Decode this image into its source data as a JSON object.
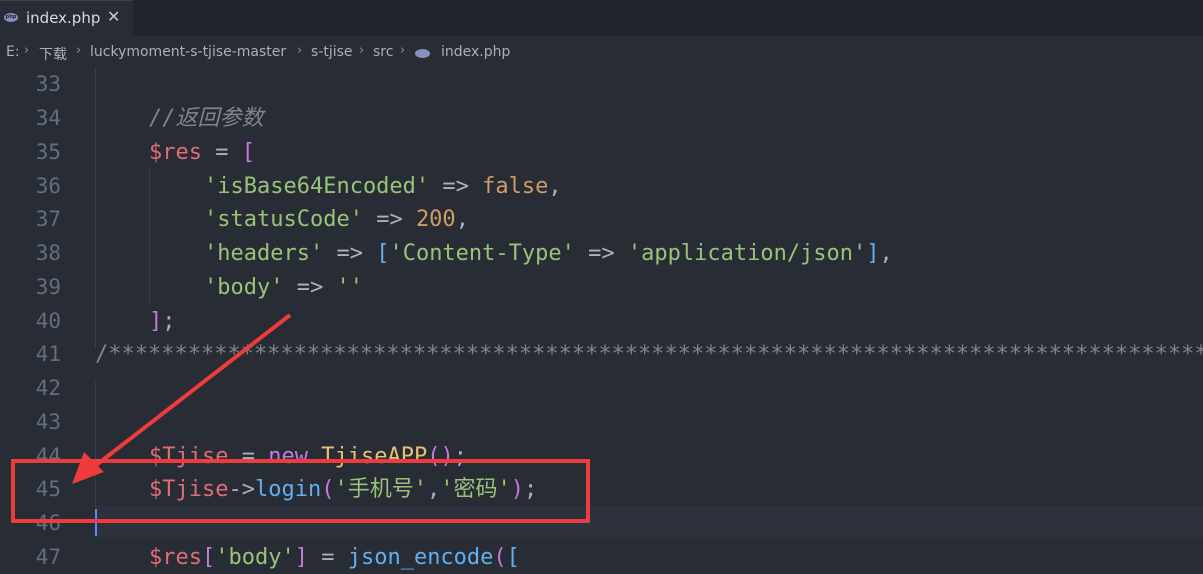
{
  "tab": {
    "title": "index.php",
    "close": "✕"
  },
  "breadcrumb": [
    "E:",
    "下载",
    "luckymoment-s-tjise-master",
    "s-tjise",
    "src",
    "index.php"
  ],
  "code": {
    "l33": "",
    "l34": "//返回参数",
    "l35a": "$res",
    "l35b": " = ",
    "l35c": "[",
    "l36a": "'isBase64Encoded'",
    "l36b": " => ",
    "l36c": "false",
    "l36d": ",",
    "l37a": "'statusCode'",
    "l37b": " => ",
    "l37c": "200",
    "l37d": ",",
    "l38a": "'headers'",
    "l38b": " => ",
    "l38c": "[",
    "l38d": "'Content-Type'",
    "l38e": " => ",
    "l38f": "'application/json'",
    "l38g": "]",
    "l38h": ",",
    "l39a": "'body'",
    "l39b": " => ",
    "l39c": "''",
    "l40a": "]",
    "l40b": ";",
    "l41": "/*************************************************************************************************************",
    "l44a": "$Tjise",
    "l44b": " = ",
    "l44c": "new",
    "l44d": " ",
    "l44e": "TjiseAPP",
    "l44f": "()",
    "l44g": ";",
    "l45a": "$Tjise",
    "l45b": "->",
    "l45c": "login",
    "l45d": "(",
    "l45e": "'手机号'",
    "l45f": ",",
    "l45g": "'密码'",
    "l45h": ")",
    "l45i": ";",
    "l47a": "$res",
    "l47b": "[",
    "l47c": "'body'",
    "l47d": "]",
    "l47e": " = ",
    "l47f": "json_encode",
    "l47g": "(",
    "l47h": "["
  },
  "line_numbers": [
    "33",
    "34",
    "35",
    "36",
    "37",
    "38",
    "39",
    "40",
    "41",
    "42",
    "43",
    "44",
    "45",
    "46",
    "47"
  ],
  "colors": {
    "background": "#282c34",
    "annotation": "#ee3b3b"
  }
}
